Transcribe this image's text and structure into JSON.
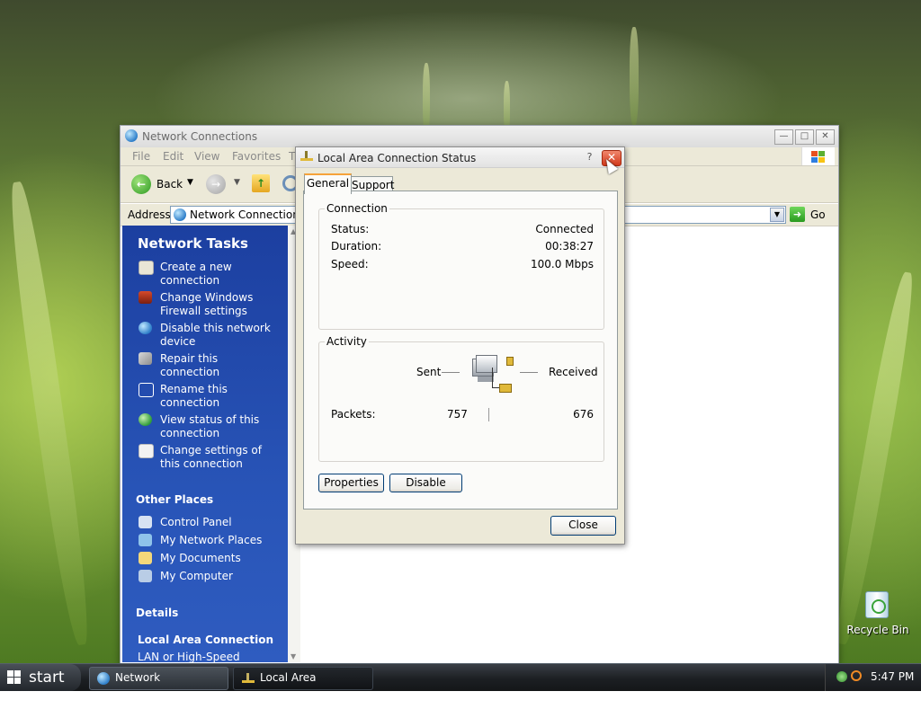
{
  "explorer": {
    "title": "Network Connections",
    "menu": [
      "File",
      "Edit",
      "View",
      "Favorites",
      "T"
    ],
    "toolbar": {
      "back_label": "Back"
    },
    "address": {
      "label": "Address",
      "value": "Network Connections",
      "go_label": "Go"
    },
    "left_pane": {
      "network_tasks_title": "Network Tasks",
      "tasks": [
        {
          "line1": "Create a new",
          "line2": "connection"
        },
        {
          "line1": "Change Windows",
          "line2": "Firewall settings"
        },
        {
          "line1": "Disable this network",
          "line2": "device"
        },
        {
          "line1": "Repair this",
          "line2": "connection"
        },
        {
          "line1": "Rename this",
          "line2": "connection"
        },
        {
          "line1": "View status of this",
          "line2": "connection"
        },
        {
          "line1": "Change settings of",
          "line2": "this connection"
        }
      ],
      "other_places_title": "Other Places",
      "other_places": [
        "Control Panel",
        "My Network Places",
        "My Documents",
        "My Computer"
      ],
      "details_title": "Details",
      "details_name": "Local Area Connection",
      "details_type": "LAN or High-Speed"
    }
  },
  "dialog": {
    "title": "Local Area Connection Status",
    "help_glyph": "?",
    "tabs": [
      "General",
      "Support"
    ],
    "connection": {
      "label": "Connection",
      "status_label": "Status:",
      "status_value": "Connected",
      "duration_label": "Duration:",
      "duration_value": "00:38:27",
      "speed_label": "Speed:",
      "speed_value": "100.0 Mbps"
    },
    "activity": {
      "label": "Activity",
      "sent_label": "Sent",
      "received_label": "Received",
      "packets_label": "Packets:",
      "packets_sent": "757",
      "packets_received": "676"
    },
    "buttons": {
      "properties": "Properties",
      "disable": "Disable",
      "close": "Close"
    }
  },
  "desktop": {
    "recycle_bin_label": "Recycle Bin"
  },
  "taskbar": {
    "start_label": "start",
    "tasks": [
      "Network Connections",
      "Local Area Connecti..."
    ],
    "clock": "5:47 PM"
  }
}
